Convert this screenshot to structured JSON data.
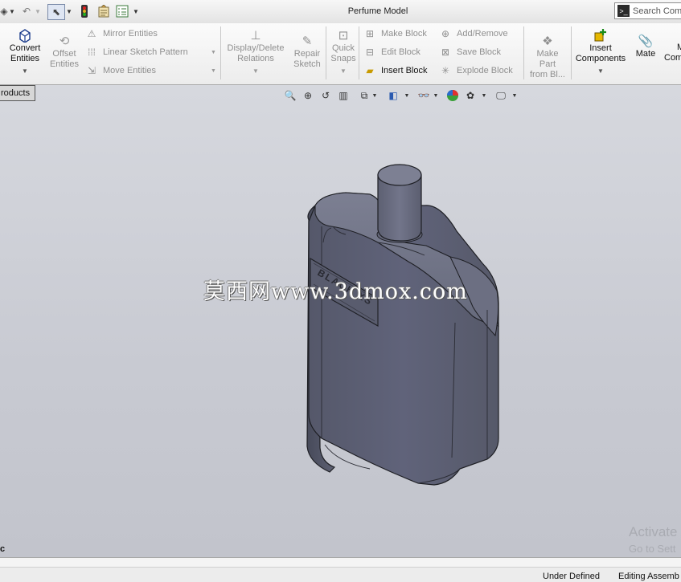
{
  "window": {
    "title": "Perfume Model"
  },
  "search": {
    "placeholder": "Search Com"
  },
  "ribbon": {
    "convert_entities": [
      "Convert",
      "Entities"
    ],
    "offset_entities": [
      "Offset",
      "Entities"
    ],
    "mirror_entities": "Mirror Entities",
    "linear_sketch_pattern": "Linear Sketch Pattern",
    "move_entities": "Move Entities",
    "display_delete_relations": [
      "Display/Delete",
      "Relations"
    ],
    "repair_sketch": [
      "Repair",
      "Sketch"
    ],
    "quick_snaps": [
      "Quick",
      "Snaps"
    ],
    "make_block": "Make Block",
    "edit_block": "Edit Block",
    "insert_block": "Insert Block",
    "add_remove": "Add/Remove",
    "save_block": "Save Block",
    "explode_block": "Explode Block",
    "make_part_from_block": [
      "Make",
      "Part",
      "from Bl..."
    ],
    "insert_components": [
      "Insert",
      "Components"
    ],
    "mate": "Mate",
    "next_command": [
      "M",
      "Com"
    ]
  },
  "viewport": {
    "tab_label": "roducts",
    "watermark": "莫西网www.3dmox.com",
    "bottle_label_text": "BLACK XS",
    "activate_title": "Activate",
    "activate_sub": "Go to Sett",
    "doc_label": "c"
  },
  "status": {
    "under_defined": "Under Defined",
    "editing": "Editing Assemb"
  },
  "colors": {
    "viewport_bg": "#c9cbd3",
    "model_body": "#5e6170",
    "model_edge": "#1e1f24",
    "ribbon_bg": "#f1f1f1"
  },
  "icons": {
    "save": "floppy-icon",
    "undo": "undo-icon",
    "select": "cursor-icon",
    "rebuild": "traffic-light-icon",
    "options": "clipboard-icon",
    "search": "terminal-icon"
  }
}
